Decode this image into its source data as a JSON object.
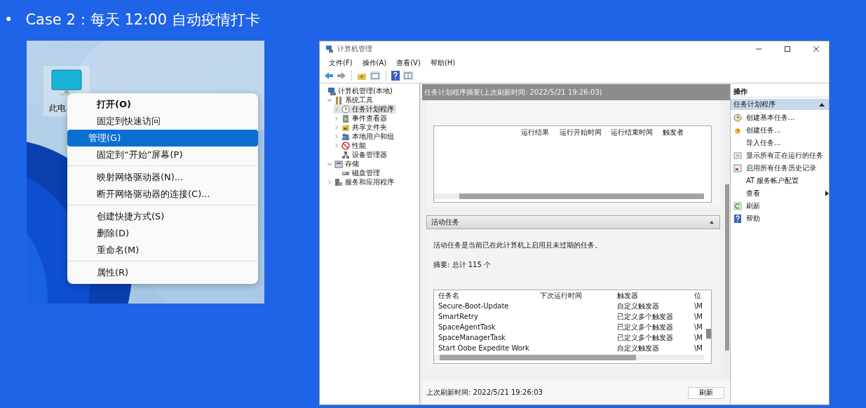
{
  "slide": {
    "bullet": "•",
    "title": "Case 2：每天 12:00 自动疫情打卡"
  },
  "desktop": {
    "kind": "picture",
    "icon_label": "此电",
    "menu": [
      [
        {
          "label": "打开(O)",
          "default": true,
          "selected": false
        },
        {
          "label": "固定到快速访问",
          "default": false,
          "selected": false
        },
        {
          "label": "管理(G)",
          "default": false,
          "selected": true
        },
        {
          "label": "固定到“开始”屏幕(P)",
          "default": false,
          "selected": false
        }
      ],
      [
        {
          "label": "映射网络驱动器(N)...",
          "default": false,
          "selected": false
        },
        {
          "label": "断开网络驱动器的连接(C)...",
          "default": false,
          "selected": false
        }
      ],
      [
        {
          "label": "创建快捷方式(S)",
          "default": false,
          "selected": false
        },
        {
          "label": "删除(D)",
          "default": false,
          "selected": false
        },
        {
          "label": "重命名(M)",
          "default": false,
          "selected": false
        }
      ],
      [
        {
          "label": "属性(R)",
          "default": false,
          "selected": false
        }
      ]
    ]
  },
  "window": {
    "title": "计算机管理",
    "menu": [
      "文件(F)",
      "操作(A)",
      "查看(V)",
      "帮助(H)"
    ],
    "tree": [
      {
        "label": "计算机管理(本地)",
        "selected": false,
        "children": [
          {
            "label": "系统工具",
            "expanded": true,
            "selected": false,
            "children": [
              {
                "label": "任务计划程序",
                "expanded": false,
                "selected": true
              },
              {
                "label": "事件查看器",
                "expanded": false,
                "selected": false
              },
              {
                "label": "共享文件夹",
                "expanded": false,
                "selected": false
              },
              {
                "label": "本地用户和组",
                "expanded": false,
                "selected": false
              },
              {
                "label": "性能",
                "expanded": false,
                "selected": false
              },
              {
                "label": "设备管理器",
                "selected": false
              }
            ]
          },
          {
            "label": "存储",
            "expanded": true,
            "selected": false,
            "children": [
              {
                "label": "磁盘管理",
                "selected": false
              }
            ]
          },
          {
            "label": "服务和应用程序",
            "expanded": false,
            "selected": false
          }
        ]
      }
    ],
    "center": {
      "header": "任务计划程序摘要(上次刷新时间: 2022/5/21 19:26:03)",
      "status_table": {
        "columns": [
          "运行结果",
          "运行开始时间",
          "运行结束时间",
          "触发者"
        ]
      },
      "section": {
        "title": "活动任务",
        "expanded": true,
        "description": "活动任务是当前已在此计算机上启用且未过期的任务。",
        "summary": "摘要: 总计 115 个",
        "table": {
          "columns": [
            "任务名",
            "下次运行时间",
            "触发器",
            "位"
          ],
          "rows": [
            [
              "Secure-Boot-Update",
              "",
              "自定义触发器",
              "\\M"
            ],
            [
              "SmartRetry",
              "",
              "已定义多个触发器",
              "\\M"
            ],
            [
              "SpaceAgentTask",
              "",
              "已定义多个触发器",
              "\\M"
            ],
            [
              "SpaceManagerTask",
              "",
              "已定义多个触发器",
              "\\M"
            ],
            [
              "Start Oobe Expedite Work",
              "",
              "自定义触发器",
              "\\M"
            ]
          ]
        }
      },
      "last_refresh": "上次刷新时间: 2022/5/21 19:26:03",
      "refresh_button": "刷新"
    },
    "actions": {
      "title": "操作",
      "group": "任务计划程序",
      "expanded": true,
      "items": [
        {
          "label": "创建基本任务...",
          "kind": "icon"
        },
        {
          "label": "创建任务...",
          "kind": "icon"
        },
        {
          "label": "导入任务...",
          "kind": "plain"
        },
        {
          "label": "显示所有正在运行的任务",
          "kind": "icon"
        },
        {
          "label": "启用所有任务历史记录",
          "kind": "icon"
        },
        {
          "label": "AT 服务帐户配置",
          "kind": "plain"
        },
        {
          "label": "查看",
          "kind": "submenu"
        },
        {
          "label": "刷新",
          "kind": "icon"
        },
        {
          "label": "帮助",
          "kind": "icon"
        }
      ]
    }
  }
}
